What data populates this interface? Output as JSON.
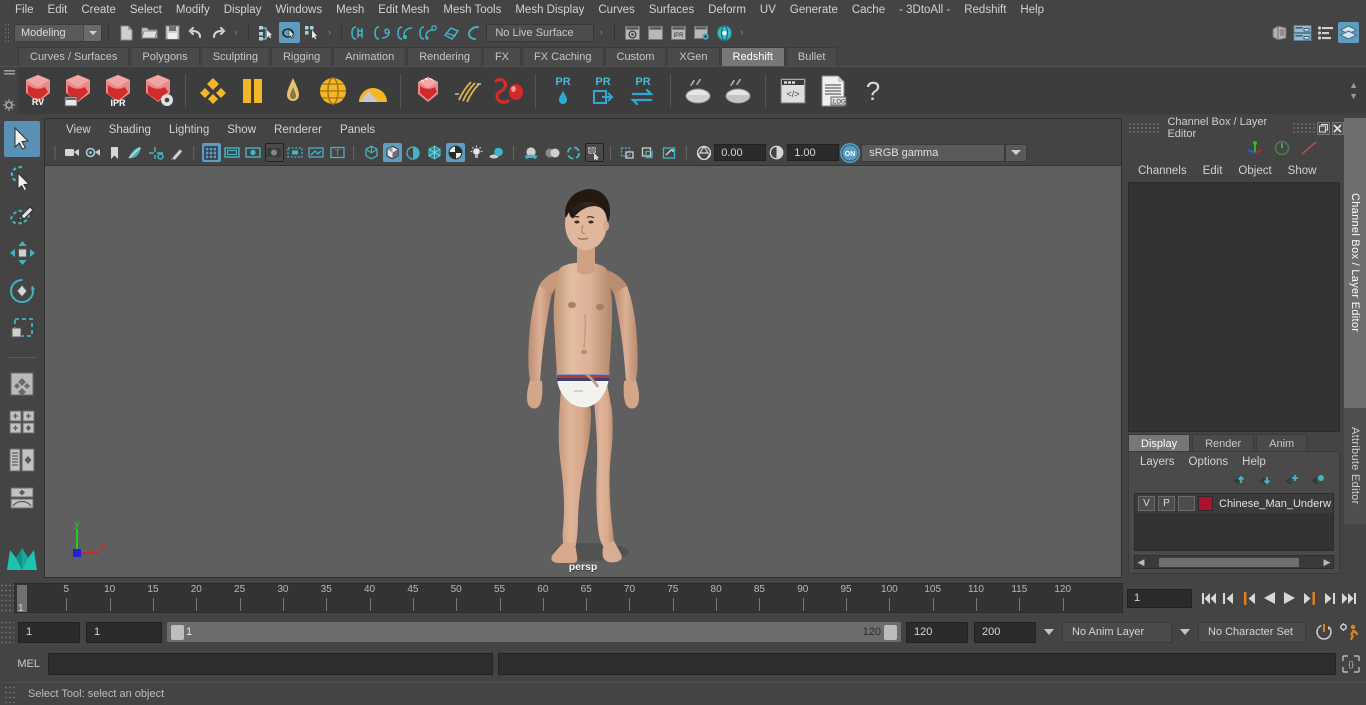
{
  "menubar": {
    "items": [
      "File",
      "Edit",
      "Create",
      "Select",
      "Modify",
      "Display",
      "Windows",
      "Mesh",
      "Edit Mesh",
      "Mesh Tools",
      "Mesh Display",
      "Curves",
      "Surfaces",
      "Deform",
      "UV",
      "Generate",
      "Cache",
      "- 3DtoAll -",
      "Redshift",
      "Help"
    ]
  },
  "statusline": {
    "menuset": "Modeling",
    "live_surface": "No Live Surface",
    "icons": [
      "new-scene-icon",
      "open-scene-icon",
      "save-scene-icon",
      "undo-icon",
      "redo-icon",
      "select-hierarchy-icon",
      "select-object-icon",
      "select-component-icon",
      "snap-grid-icon",
      "snap-curve-icon",
      "snap-point-icon",
      "snap-projected-icon",
      "snap-view-plane-icon",
      "make-live-icon",
      "render-view-icon",
      "render-current-frame-icon",
      "ipr-render-icon",
      "render-settings-icon",
      "hypershade-icon",
      "toggle-outliner-icon",
      "toggle-attribute-editor-icon",
      "toggle-channel-box-icon",
      "toggle-layer-editor-icon"
    ]
  },
  "shelf": {
    "tabs": [
      "Curves / Surfaces",
      "Polygons",
      "Sculpting",
      "Rigging",
      "Animation",
      "Rendering",
      "FX",
      "FX Caching",
      "Custom",
      "XGen",
      "Redshift",
      "Bullet"
    ],
    "active_tab": "Redshift",
    "buttons": [
      {
        "name": "redshift-render-view",
        "label": "RV"
      },
      {
        "name": "redshift-render-sequence",
        "label": ""
      },
      {
        "name": "redshift-ipr",
        "label": "IPR"
      },
      {
        "name": "redshift-render-settings",
        "label": ""
      },
      {
        "name": "redshift-material",
        "label": ""
      },
      {
        "name": "redshift-material-blender",
        "label": ""
      },
      {
        "name": "redshift-light-area",
        "label": ""
      },
      {
        "name": "redshift-light-dome",
        "label": ""
      },
      {
        "name": "redshift-light-physical-sun",
        "label": ""
      },
      {
        "name": "redshift-proxy",
        "label": ""
      },
      {
        "name": "redshift-hair",
        "label": ""
      },
      {
        "name": "redshift-volume",
        "label": ""
      },
      {
        "name": "redshift-sphere",
        "label": ""
      },
      {
        "name": "redshift-proxy-pr",
        "label": "PR"
      },
      {
        "name": "redshift-export-pr",
        "label": "PR"
      },
      {
        "name": "redshift-convert-pr",
        "label": "PR"
      },
      {
        "name": "redshift-bake-set",
        "label": ""
      },
      {
        "name": "redshift-bake-render",
        "label": ""
      },
      {
        "name": "redshift-script-editor",
        "label": ""
      },
      {
        "name": "redshift-log",
        "label": ".LOG"
      },
      {
        "name": "redshift-help",
        "label": "?"
      }
    ]
  },
  "left_toolbar": {
    "items": [
      "select-tool",
      "lasso-select-tool",
      "paint-select-tool",
      "move-tool",
      "rotate-tool",
      "scale-tool",
      "last-tool-used",
      "single-perspective-view-layout",
      "four-view-layout",
      "outliner-persp-layout",
      "persp-graph-layout",
      "maya-logo"
    ]
  },
  "viewport": {
    "menus": [
      "View",
      "Shading",
      "Lighting",
      "Show",
      "Renderer",
      "Panels"
    ],
    "camera_label": "persp",
    "exposure": "0.00",
    "gamma": "1.00",
    "color_space": "sRGB gamma",
    "axis": {
      "x": "x",
      "y": "y",
      "z": "z"
    },
    "toolbar_icons": [
      "camera-icon",
      "camera-attributes-icon",
      "bookmark-icon",
      "image-plane-icon",
      "two-d-pan-zoom-icon",
      "grease-pencil-icon",
      "grid-icon",
      "film-gate-icon",
      "resolution-gate-icon",
      "gate-mask-icon",
      "film-origin-icon",
      "exposure-icon",
      "xray-icon",
      "wireframe-icon",
      "smooth-shade-icon",
      "shade-flat-icon",
      "wireframe-on-shaded-icon",
      "textured-icon",
      "use-all-lights-icon",
      "shadows-icon",
      "screen-space-ao-icon",
      "motion-blur-icon",
      "multisample-icon",
      "isolate-select-icon",
      "xray-joints-icon",
      "xray-active-components-icon",
      "toggle-selection-highlight-icon",
      "aperture-icon",
      "gamma-icon",
      "color-management-icon"
    ]
  },
  "right_panel": {
    "title": "Channel Box / Layer Editor",
    "menus": [
      "Channels",
      "Edit",
      "Object",
      "Show"
    ],
    "tabs": [
      "Display",
      "Render",
      "Anim"
    ],
    "active_tab": "Display",
    "layer_menus": [
      "Layers",
      "Options",
      "Help"
    ],
    "layers": [
      {
        "visibility": "V",
        "playback": "P",
        "shading": "",
        "color": "#b01030",
        "name": "Chinese_Man_Underw"
      }
    ],
    "vertical_tabs": [
      {
        "label": "Channel Box / Layer Editor",
        "active": true
      },
      {
        "label": "Attribute Editor",
        "active": false
      }
    ]
  },
  "timeline": {
    "ticks": [
      5,
      10,
      15,
      20,
      25,
      30,
      35,
      40,
      45,
      50,
      55,
      60,
      65,
      70,
      75,
      80,
      85,
      90,
      95,
      100,
      105,
      110,
      115,
      120
    ],
    "current_frame_marker": "1",
    "current_frame_field": "1",
    "playback_buttons": [
      "go-to-start-icon",
      "step-back-keyframe-icon",
      "step-back-frame-icon",
      "play-backwards-icon",
      "play-forwards-icon",
      "step-forward-frame-icon",
      "step-forward-keyframe-icon",
      "go-to-end-icon"
    ]
  },
  "range_slider": {
    "anim_start": "1",
    "range_start": "1",
    "bar_min": "1",
    "bar_max": "120",
    "range_end": "120",
    "anim_end": "200",
    "anim_layer": "No Anim Layer",
    "character_set": "No Character Set",
    "icons": [
      "auto-keyframe-icon",
      "animation-preferences-icon"
    ]
  },
  "command_line": {
    "language": "MEL",
    "input_value": "",
    "output_value": "",
    "script_editor_icon": "script-editor-icon"
  },
  "status_bar": {
    "help_text": "Select Tool: select an object"
  },
  "colors": {
    "accent_blue": "#5e9cc0",
    "panel_bg": "#444444",
    "viewport_bg": "#5f5f5f",
    "field_bg": "#2b2b2b",
    "layer_red": "#b01030",
    "orange": "#e08020"
  }
}
